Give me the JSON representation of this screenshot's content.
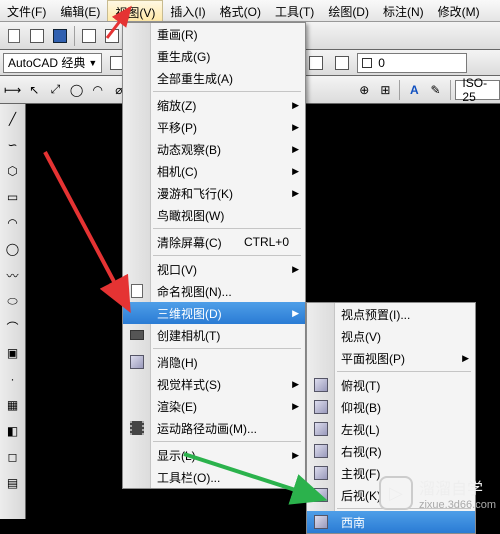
{
  "menubar": {
    "items": [
      "文件(F)",
      "编辑(E)",
      "视图(V)",
      "插入(I)",
      "格式(O)",
      "工具(T)",
      "绘图(D)",
      "标注(N)",
      "修改(M)"
    ],
    "active_index": 2
  },
  "row3": {
    "workspace": "AutoCAD 经典",
    "layer": "0"
  },
  "row4": {
    "dimstyle": "ISO-25"
  },
  "main_menu": [
    {
      "label": "重画(R)"
    },
    {
      "label": "重生成(G)"
    },
    {
      "label": "全部重生成(A)"
    },
    {
      "sep": true
    },
    {
      "label": "缩放(Z)",
      "sub": true
    },
    {
      "label": "平移(P)",
      "sub": true
    },
    {
      "label": "动态观察(B)",
      "sub": true
    },
    {
      "label": "相机(C)",
      "sub": true
    },
    {
      "label": "漫游和飞行(K)",
      "sub": true
    },
    {
      "label": "鸟瞰视图(W)"
    },
    {
      "sep": true
    },
    {
      "label": "清除屏幕(C)",
      "short": "CTRL+0"
    },
    {
      "sep": true
    },
    {
      "label": "视口(V)",
      "sub": true
    },
    {
      "label": "命名视图(N)...",
      "icon": "page"
    },
    {
      "label": "三维视图(D)",
      "sub": true,
      "sel": true
    },
    {
      "label": "创建相机(T)",
      "icon": "cam"
    },
    {
      "sep": true
    },
    {
      "label": "消隐(H)",
      "icon": "cube"
    },
    {
      "label": "视觉样式(S)",
      "sub": true
    },
    {
      "label": "渲染(E)",
      "sub": true
    },
    {
      "label": "运动路径动画(M)...",
      "icon": "film"
    },
    {
      "sep": true
    },
    {
      "label": "显示(L)",
      "sub": true
    },
    {
      "label": "工具栏(O)..."
    }
  ],
  "sub_menu": [
    {
      "label": "视点预置(I)..."
    },
    {
      "label": "视点(V)"
    },
    {
      "label": "平面视图(P)",
      "sub": true
    },
    {
      "sep": true
    },
    {
      "label": "俯视(T)",
      "icon": "cube"
    },
    {
      "label": "仰视(B)",
      "icon": "cube"
    },
    {
      "label": "左视(L)",
      "icon": "cube"
    },
    {
      "label": "右视(R)",
      "icon": "cube"
    },
    {
      "label": "主视(F)",
      "icon": "cube"
    },
    {
      "label": "后视(K)",
      "icon": "cube"
    },
    {
      "sep": true
    },
    {
      "label": "西南",
      "icon": "cube",
      "sel": true
    }
  ],
  "watermark": {
    "name": "溜溜自学",
    "url": "zixue.3d66.com"
  }
}
